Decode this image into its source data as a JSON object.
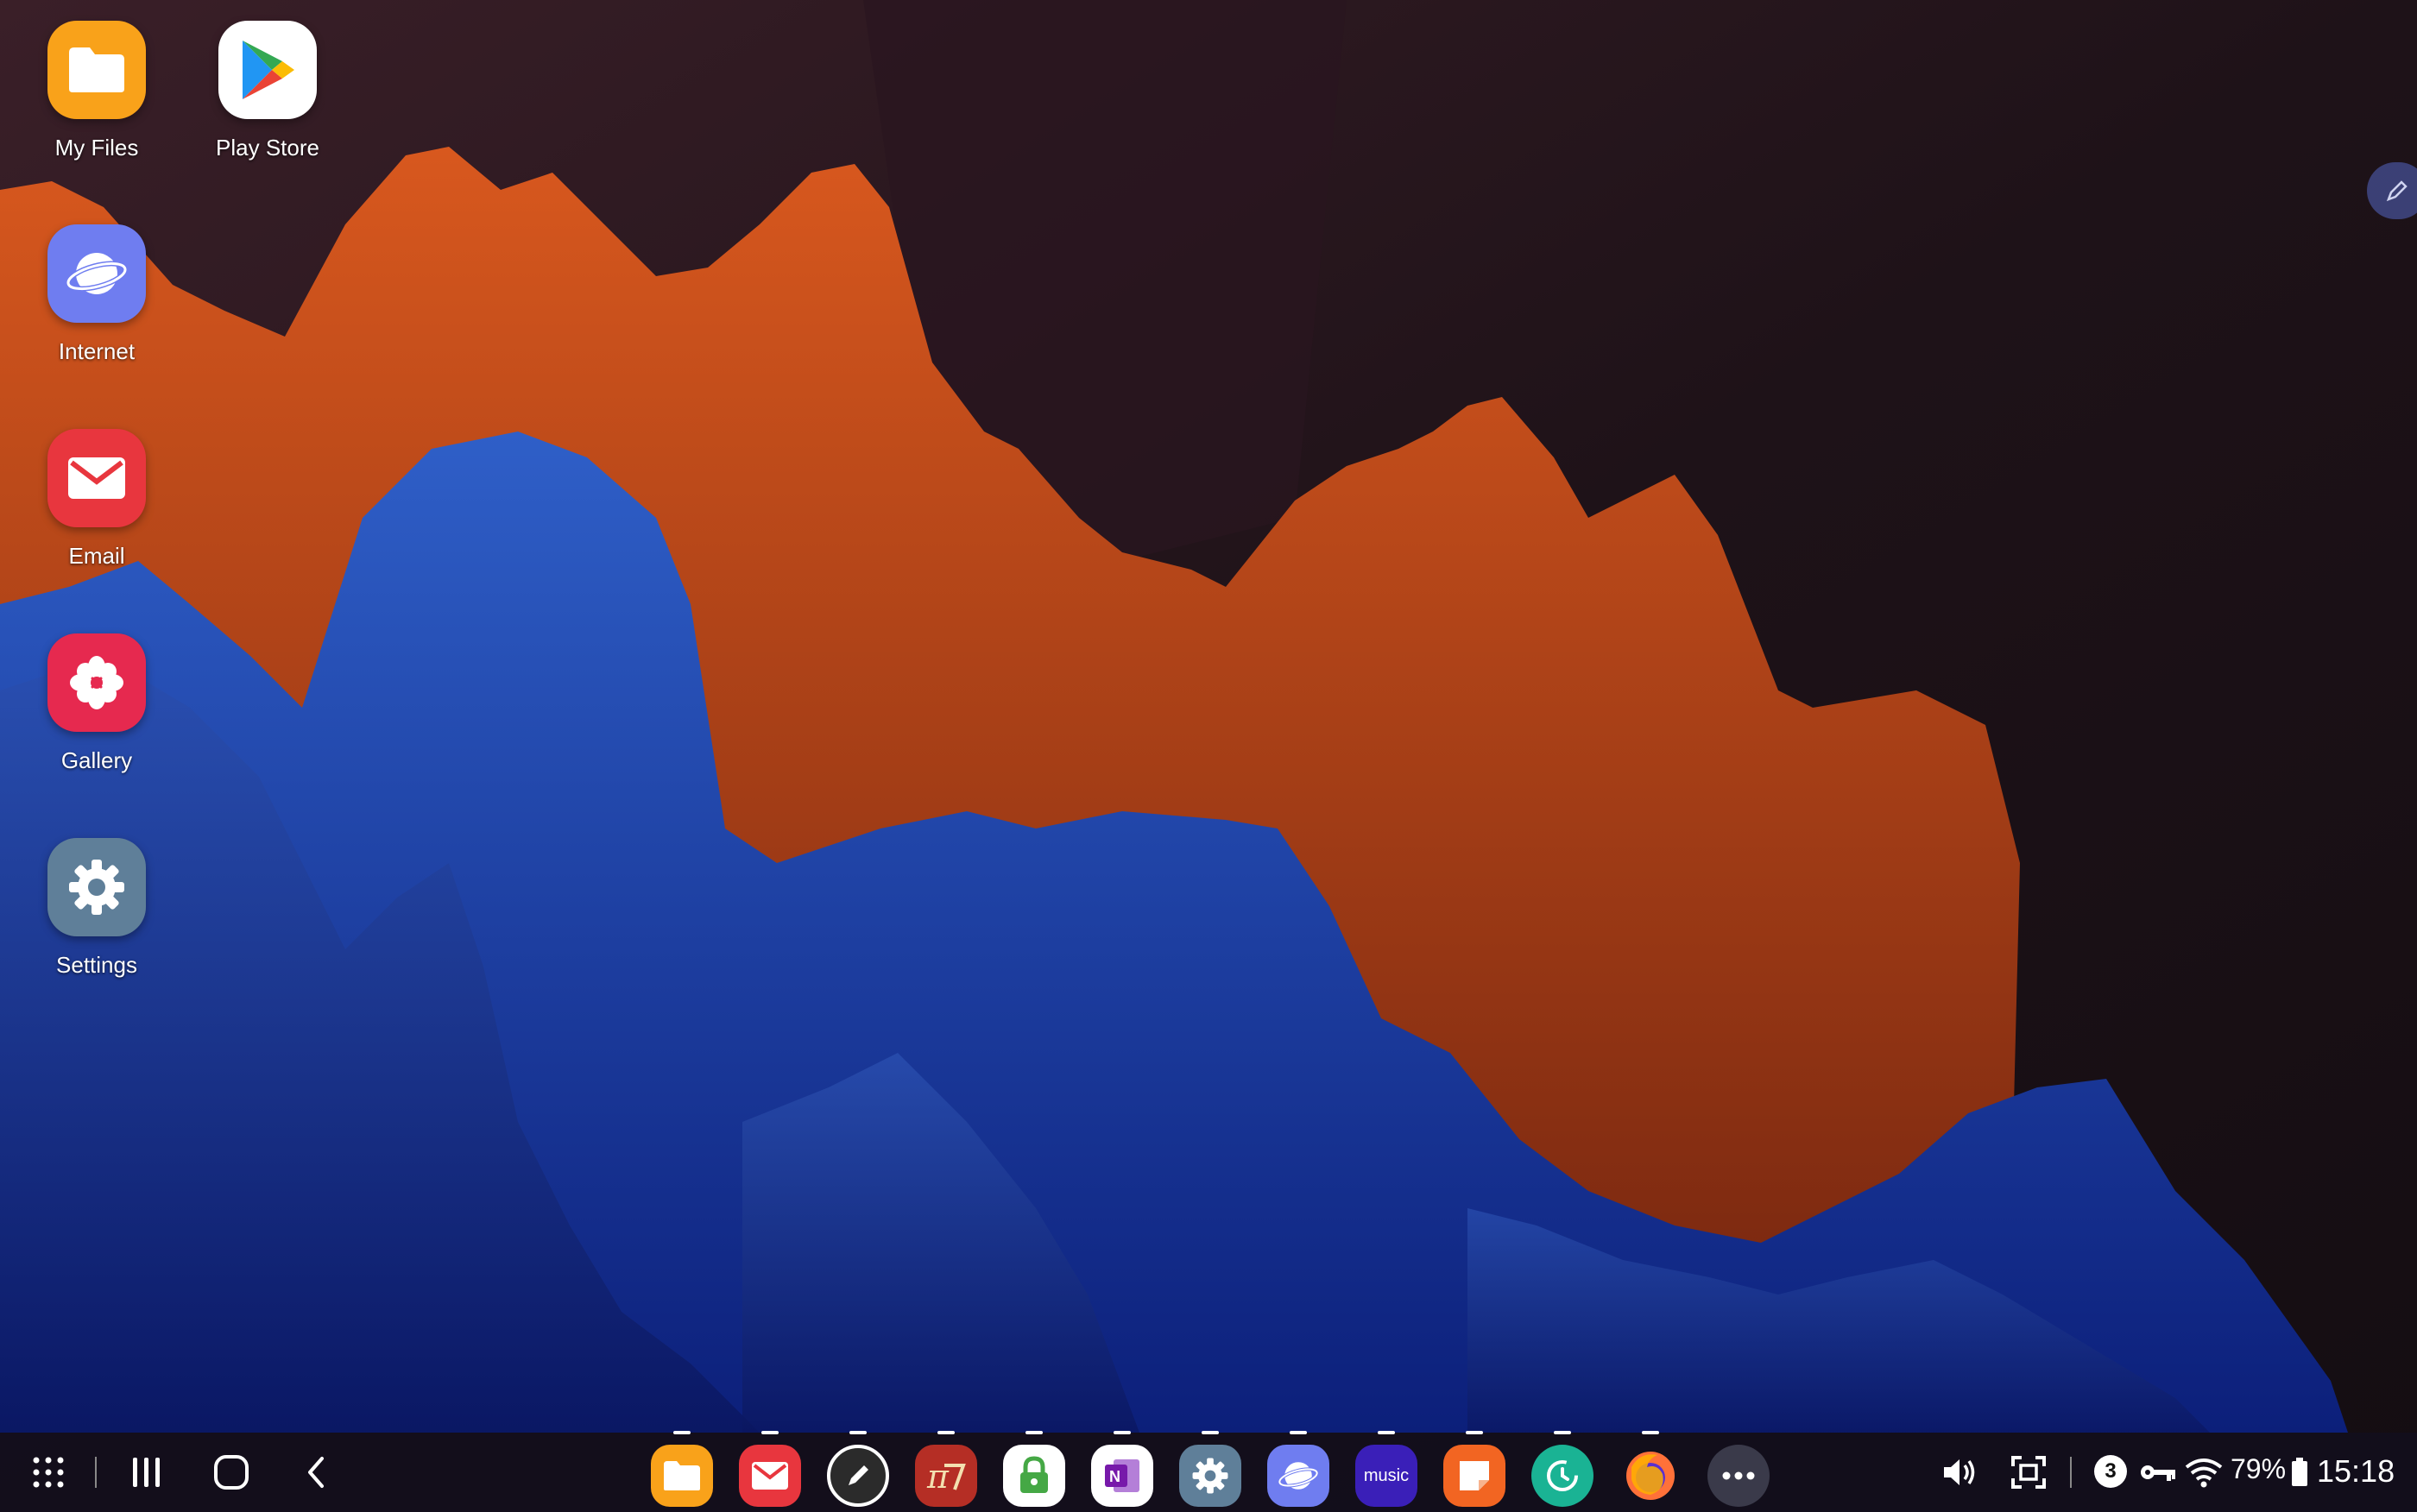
{
  "desktop": {
    "icons": [
      {
        "label": "My Files",
        "icon": "folder-icon",
        "color": "#f9a21a"
      },
      {
        "label": "Play Store",
        "icon": "play-store-icon",
        "color": "#ffffff"
      },
      {
        "label": "Internet",
        "icon": "internet-icon",
        "color": "#6f7df0"
      },
      {
        "label": "Email",
        "icon": "email-icon",
        "color": "#e8363e"
      },
      {
        "label": "Gallery",
        "icon": "gallery-icon",
        "color": "#e6294f"
      },
      {
        "label": "Settings",
        "icon": "settings-icon",
        "color": "#5f7f99"
      }
    ]
  },
  "taskbar": {
    "nav": [
      "apps-grid-icon",
      "recents-icon",
      "home-icon",
      "back-icon"
    ],
    "apps": [
      {
        "icon": "folder-icon",
        "color": "#f9a21a"
      },
      {
        "icon": "email-icon",
        "color": "#e8363e"
      },
      {
        "icon": "pen-icon",
        "color": "#2b2b2b"
      },
      {
        "icon": "texmaker-icon",
        "color": "#b52e25"
      },
      {
        "icon": "vpn-lock-icon",
        "color": "#ffffff"
      },
      {
        "icon": "onenote-icon",
        "color": "#ffffff"
      },
      {
        "icon": "settings-icon",
        "color": "#5f7f99"
      },
      {
        "icon": "internet-icon",
        "color": "#6f7df0"
      },
      {
        "icon": "amazon-music-icon",
        "color": "#3a1fb8"
      },
      {
        "icon": "notes-icon",
        "color": "#f26522"
      },
      {
        "icon": "sync-icon",
        "color": "#1ab394"
      },
      {
        "icon": "firefox-icon",
        "color": "#ff7139"
      },
      {
        "icon": "more-icon",
        "color": "#3a3a4a"
      }
    ],
    "music_label": "music",
    "status": {
      "notification_count": "3",
      "battery": "79%",
      "time": "15:18"
    }
  }
}
